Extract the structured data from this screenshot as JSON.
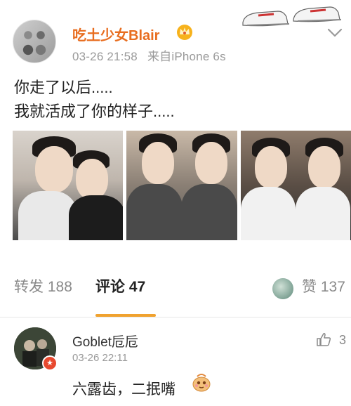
{
  "post": {
    "username": "吃土少女Blair",
    "timestamp": "03-26 21:58",
    "source": "来自iPhone 6s",
    "text_line1": "你走了以后.....",
    "text_line2": "我就活成了你的样子.....",
    "photo_count": 3
  },
  "tabs": {
    "repost": "转发 188",
    "comment": "评论 47",
    "like": "赞 137",
    "active": "comment",
    "accent_color": "#f0a22f"
  },
  "comment": {
    "username": "Goblet卮卮",
    "timestamp": "03-26 22:11",
    "text": "六露齿，二抿嘴",
    "likes": "3"
  },
  "colors": {
    "username_orange": "#e86d1f",
    "meta_gray": "#9a9a9a",
    "badge_red": "#e8492f"
  },
  "icons": {
    "vip": "crown-vip-icon",
    "more": "chevron-down-icon",
    "like": "thumb-up-icon",
    "emoji": "smiling-face-emoji"
  }
}
